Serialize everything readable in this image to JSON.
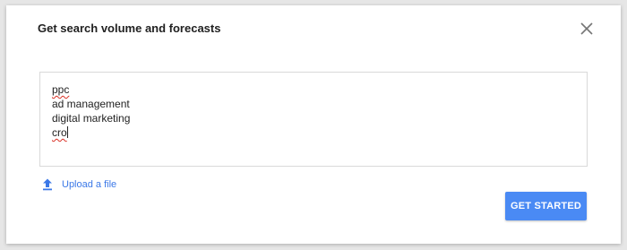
{
  "dialog": {
    "title": "Get search volume and forecasts",
    "close_icon": "close-icon"
  },
  "keywords_input": {
    "lines": [
      "ppc",
      "ad management",
      "digital marketing",
      "cro"
    ],
    "spellcheck_flagged": [
      "ppc",
      "cro"
    ]
  },
  "upload": {
    "icon": "upload-icon",
    "label": "Upload a file"
  },
  "actions": {
    "primary_label": "GET STARTED"
  },
  "colors": {
    "accent": "#4a8af4",
    "link": "#3b78e7"
  }
}
